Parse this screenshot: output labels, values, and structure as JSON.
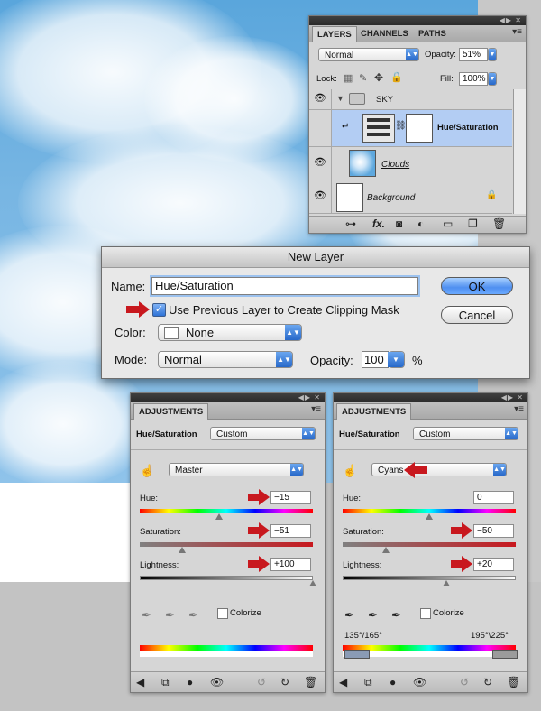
{
  "layers_panel": {
    "tabs": [
      "LAYERS",
      "CHANNELS",
      "PATHS"
    ],
    "blend_mode": "Normal",
    "opacity_label": "Opacity:",
    "opacity_value": "51%",
    "lock_label": "Lock:",
    "fill_label": "Fill:",
    "fill_value": "100%",
    "group_name": "SKY",
    "layers": [
      "Hue/Saturation",
      "Clouds",
      "Background"
    ]
  },
  "dialog": {
    "title": "New Layer",
    "name_label": "Name:",
    "name_value": "Hue/Saturation",
    "clip_checkbox_label": "Use Previous Layer to Create Clipping Mask",
    "color_label": "Color:",
    "color_value": "None",
    "mode_label": "Mode:",
    "mode_value": "Normal",
    "opacity_label": "Opacity:",
    "opacity_value": "100",
    "opacity_unit": "%",
    "ok_label": "OK",
    "cancel_label": "Cancel"
  },
  "adjustments": [
    {
      "tab": "ADJUSTMENTS",
      "type_label": "Hue/Saturation",
      "preset": "Custom",
      "channel": "Master",
      "hue_label": "Hue:",
      "hue_value": "−15",
      "hue_position": 0.458,
      "saturation_label": "Saturation:",
      "saturation_value": "−51",
      "saturation_position": 0.245,
      "lightness_label": "Lightness:",
      "lightness_value": "+100",
      "lightness_position": 1.0,
      "colorize_label": "Colorize",
      "range_left": "",
      "range_right": ""
    },
    {
      "tab": "ADJUSTMENTS",
      "type_label": "Hue/Saturation",
      "preset": "Custom",
      "channel": "Cyans",
      "hue_label": "Hue:",
      "hue_value": "0",
      "hue_position": 0.5,
      "saturation_label": "Saturation:",
      "saturation_value": "−50",
      "saturation_position": 0.25,
      "lightness_label": "Lightness:",
      "lightness_value": "+20",
      "lightness_position": 0.6,
      "colorize_label": "Colorize",
      "range_left": "135°/165°",
      "range_right": "195°\\225°"
    }
  ],
  "colors": {
    "accent_red": "#c8181e",
    "button_blue": "#4f8ff0"
  }
}
